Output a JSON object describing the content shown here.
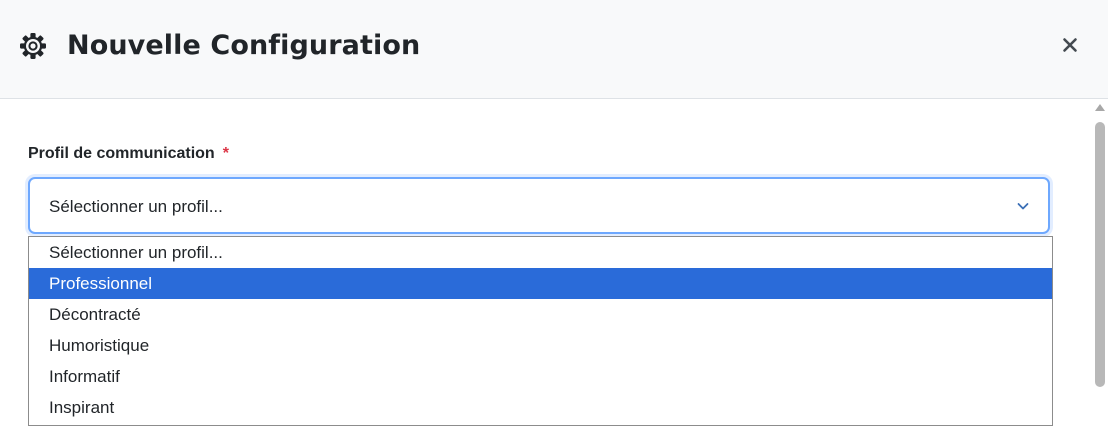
{
  "header": {
    "title": "Nouvelle Configuration",
    "icon": "gear-icon",
    "close_icon": "close-icon"
  },
  "form": {
    "label": "Profil de communication",
    "required_mark": "*",
    "select": {
      "value": "Sélectionner un profil...",
      "chevron_icon": "chevron-down-icon"
    },
    "options": [
      "Sélectionner un profil...",
      "Professionnel",
      "Décontracté",
      "Humoristique",
      "Informatif",
      "Inspirant"
    ],
    "highlighted_option": "Professionnel"
  },
  "colors": {
    "header_bg": "#f8f9fa",
    "focus_border": "#6ea8fe",
    "highlight": "#2a6bd9",
    "required": "#dc3545"
  }
}
